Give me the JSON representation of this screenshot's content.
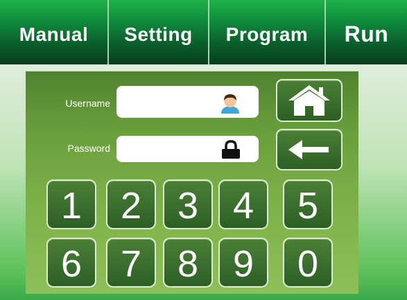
{
  "tabs": [
    {
      "label": "Manual"
    },
    {
      "label": "Setting"
    },
    {
      "label": "Program"
    },
    {
      "label": "Run"
    }
  ],
  "login": {
    "username_label": "Username",
    "password_label": "Password",
    "username_value": "",
    "password_value": ""
  },
  "icons": {
    "username": "user-avatar-icon",
    "password": "lock-icon",
    "home": "home-icon",
    "back": "arrow-left-icon"
  },
  "keypad": {
    "keys": [
      "1",
      "2",
      "3",
      "4",
      "5",
      "6",
      "7",
      "8",
      "9",
      "0"
    ]
  },
  "colors": {
    "tab_green": "#0e8c3c",
    "panel_green": "#6b9f3c",
    "button_green": "#3e7030",
    "text": "#ffffff"
  }
}
